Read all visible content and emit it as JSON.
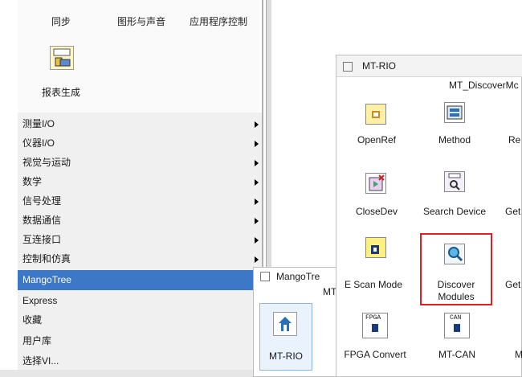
{
  "palette": {
    "tabs": [
      "同步",
      "图形与声音",
      "应用程序控制"
    ],
    "report_label": "报表生成"
  },
  "menu": {
    "items": [
      {
        "label": "测量I/O",
        "submenu": true,
        "selected": false
      },
      {
        "label": "仪器I/O",
        "submenu": true,
        "selected": false
      },
      {
        "label": "视觉与运动",
        "submenu": true,
        "selected": false
      },
      {
        "label": "数学",
        "submenu": true,
        "selected": false
      },
      {
        "label": "信号处理",
        "submenu": true,
        "selected": false
      },
      {
        "label": "数据通信",
        "submenu": true,
        "selected": false
      },
      {
        "label": "互连接口",
        "submenu": true,
        "selected": false
      },
      {
        "label": "控制和仿真",
        "submenu": true,
        "selected": false
      },
      {
        "label": "MangoTree",
        "submenu": true,
        "selected": true
      },
      {
        "label": "Express",
        "submenu": true,
        "selected": false
      },
      {
        "label": "收藏",
        "submenu": true,
        "selected": false
      },
      {
        "label": "用户库",
        "submenu": true,
        "selected": false
      },
      {
        "label": "选择VI...",
        "submenu": false,
        "selected": false
      }
    ],
    "selected_color": "#3c78c6"
  },
  "mangotree_window": {
    "title": "MangoTre",
    "subtitle": "MT",
    "tile_label": "MT-RIO"
  },
  "rio_window": {
    "title": "MT-RIO",
    "subtitle": "MT_DiscoverMc",
    "tiles": [
      {
        "label": "OpenRef",
        "icon": "openref-icon"
      },
      {
        "label": "Method",
        "icon": "method-icon"
      },
      {
        "label": "Re",
        "icon": "re-icon"
      },
      {
        "label": "CloseDev",
        "icon": "closedev-icon"
      },
      {
        "label": "Search Device",
        "icon": "search-device-icon"
      },
      {
        "label": "Get",
        "icon": "get-icon"
      },
      {
        "label": "E Scan Mode",
        "icon": "escan-mode-icon"
      },
      {
        "label": "Discover",
        "label2": "Modules",
        "icon": "discover-modules-icon"
      },
      {
        "label": "Get",
        "icon": "get2-icon"
      },
      {
        "label": "FPGA Convert",
        "icon": "fpga-convert-icon",
        "glyph": "FPGA"
      },
      {
        "label": "MT-CAN",
        "icon": "mt-can-icon",
        "glyph": "CAN"
      },
      {
        "label": "M",
        "icon": "m-icon"
      }
    ],
    "highlight_color": "#e02020"
  }
}
